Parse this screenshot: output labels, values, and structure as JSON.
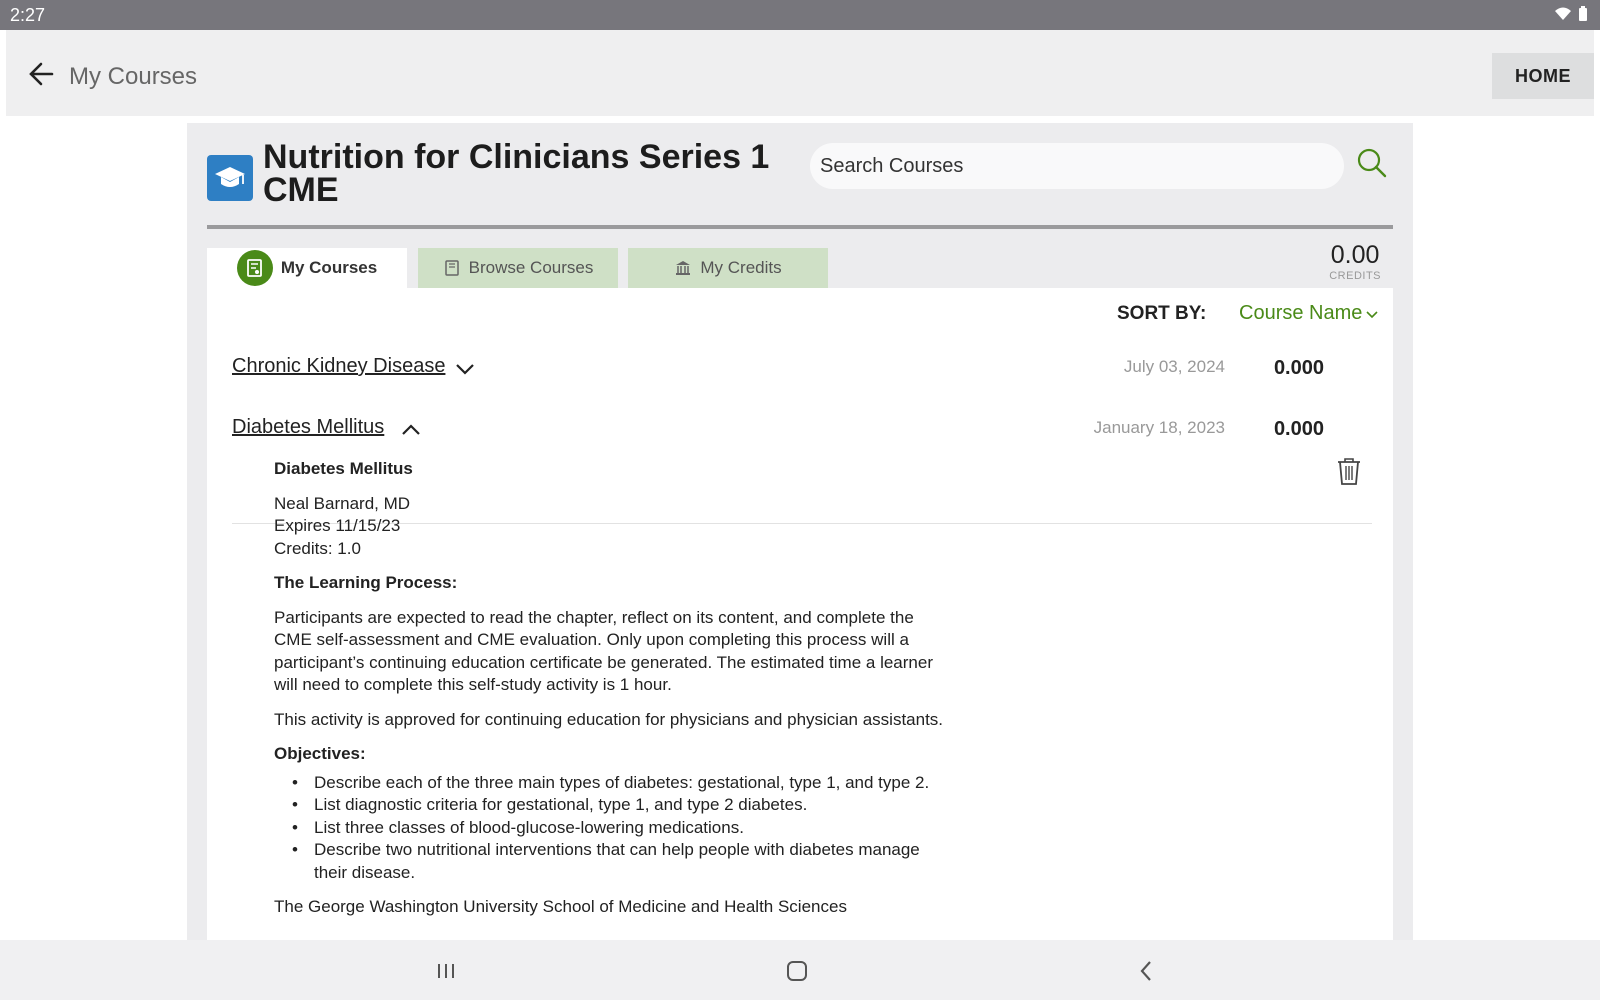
{
  "status_bar": {
    "time": "2:27",
    "icons": [
      "wifi-icon",
      "battery-icon"
    ]
  },
  "app_bar": {
    "title": "My Courses",
    "home_label": "HOME"
  },
  "course": {
    "title": "Nutrition for Clinicians Series 1 CME",
    "logo_icon": "graduation-cap-icon",
    "search_placeholder": "Search Courses"
  },
  "tabs": [
    {
      "label": "My Courses",
      "icon": "certificate-icon",
      "active": true
    },
    {
      "label": "Browse Courses",
      "icon": "book-icon",
      "active": false
    },
    {
      "label": "My Credits",
      "icon": "institution-icon",
      "active": false
    }
  ],
  "credits_total": {
    "value": "0.00",
    "label": "CREDITS"
  },
  "sort": {
    "label": "SORT BY:",
    "value": "Course Name"
  },
  "courses": [
    {
      "name": "Chronic Kidney Disease",
      "date": "July 03, 2024",
      "credits": "0.000",
      "expanded": false
    },
    {
      "name": "Diabetes Mellitus",
      "date": "January 18, 2023",
      "credits": "0.000",
      "expanded": true
    }
  ],
  "detail": {
    "title": "Diabetes Mellitus",
    "author": "Neal Barnard, MD",
    "expires": "Expires 11/15/23",
    "credits": "Credits: 1.0",
    "learning_heading": "The Learning Process:",
    "learning_text": "Participants are expected to read the chapter, reflect on its content, and complete the CME self-assessment and CME evaluation. Only upon completing this process will a participant’s continuing education certificate be generated. The estimated time a learner will need to complete this self-study activity is 1 hour.",
    "approval_text": "This activity is approved for continuing education for physicians and physician assistants.",
    "objectives_heading": "Objectives:",
    "objectives": [
      "Describe each of the three main types of diabetes: gestational, type 1, and type 2.",
      "List diagnostic criteria for gestational, type 1, and type 2 diabetes.",
      "List three classes of blood-glucose-lowering medications.",
      "Describe two nutritional interventions that can help people with diabetes manage their disease."
    ],
    "footer_text": "The George Washington University School of Medicine and Health Sciences"
  },
  "colors": {
    "accent_green": "#4a8a18",
    "tab_inactive": "#cfe0c6",
    "logo_blue": "#2e7fc4"
  }
}
